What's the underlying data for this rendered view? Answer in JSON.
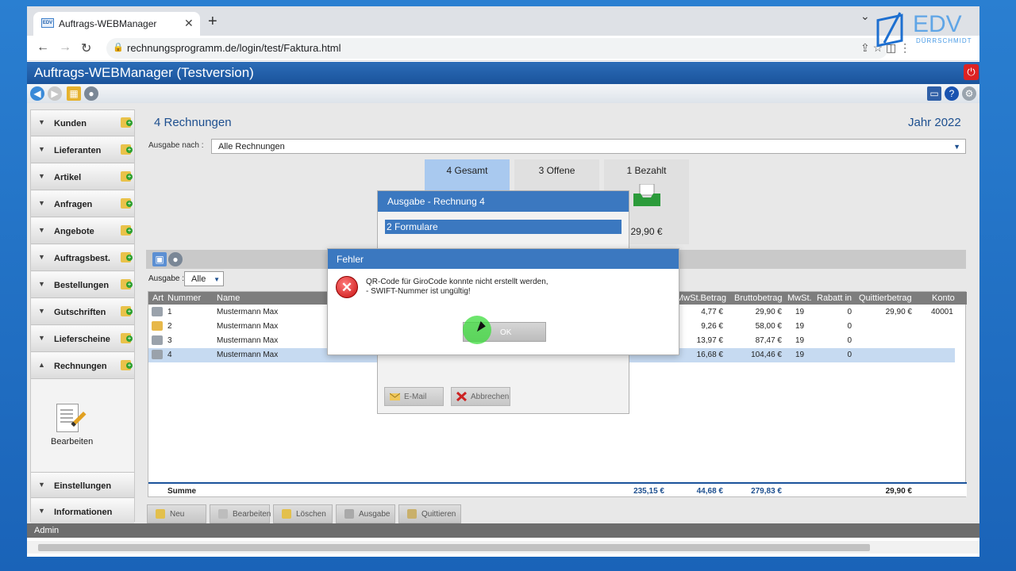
{
  "browser": {
    "tab_title": "Auftrags-WEBManager",
    "tab_favicon_text": "EDV",
    "url": "rechnungsprogramm.de/login/test/Faktura.html"
  },
  "app": {
    "title": "Auftrags-WEBManager (Testversion)",
    "status_user": "Admin"
  },
  "sidebar": {
    "items": [
      {
        "label": "Kunden"
      },
      {
        "label": "Lieferanten"
      },
      {
        "label": "Artikel"
      },
      {
        "label": "Anfragen"
      },
      {
        "label": "Angebote"
      },
      {
        "label": "Auftragsbest."
      },
      {
        "label": "Bestellungen"
      },
      {
        "label": "Gutschriften"
      },
      {
        "label": "Lieferscheine"
      },
      {
        "label": "Rechnungen"
      }
    ],
    "sub_action": "Bearbeiten",
    "bottom_items": [
      {
        "label": "Einstellungen"
      },
      {
        "label": "Informationen"
      }
    ]
  },
  "main": {
    "title": "4 Rechnungen",
    "year": "Jahr 2022",
    "ausgabe_nach_label": "Ausgabe nach :",
    "ausgabe_nach_value": "Alle Rechnungen",
    "stats": [
      {
        "label": "4 Gesamt",
        "value": ""
      },
      {
        "label": "3 Offene",
        "value": ""
      },
      {
        "label": "1 Bezahlt",
        "value": "29,90 €"
      }
    ],
    "ausgabe_label": "Ausgabe :",
    "ausgabe_value": "Alle",
    "columns": [
      "Art",
      "Nummer",
      "Name",
      "MwSt.Betrag",
      "Bruttobetrag",
      "MwSt.",
      "Rabatt in",
      "Quittierbetrag",
      "Konto"
    ],
    "rows": [
      {
        "nummer": "1",
        "name": "Mustermann Max",
        "mwst_betrag": "4,77 €",
        "brutto": "29,90 €",
        "mwst": "19",
        "rabatt": "0",
        "quittier": "29,90 €",
        "konto": "40001",
        "icon": "printer"
      },
      {
        "nummer": "2",
        "name": "Mustermann Max",
        "mwst_betrag": "9,26 €",
        "brutto": "58,00 €",
        "mwst": "19",
        "rabatt": "0",
        "quittier": "",
        "konto": "",
        "icon": "envelope"
      },
      {
        "nummer": "3",
        "name": "Mustermann Max",
        "mwst_betrag": "13,97 €",
        "brutto": "87,47 €",
        "mwst": "19",
        "rabatt": "0",
        "quittier": "",
        "konto": "",
        "icon": "printer"
      },
      {
        "nummer": "4",
        "name": "Mustermann Max",
        "mwst_betrag": "16,68 €",
        "brutto": "104,46 €",
        "mwst": "19",
        "rabatt": "0",
        "quittier": "",
        "konto": "",
        "icon": "printer"
      }
    ],
    "sum": {
      "label": "Summe",
      "netto": "235,15 €",
      "mwst_betrag": "44,68 €",
      "brutto": "279,83 €",
      "quittier": "29,90 €"
    },
    "buttons": [
      "Neu",
      "Bearbeiten",
      "Löschen",
      "Ausgabe",
      "Quittieren"
    ]
  },
  "ausgabe_dialog": {
    "title": "Ausgabe - Rechnung 4",
    "section": "2 Formulare",
    "email_label": "E-Mail",
    "cancel_label": "Abbrechen"
  },
  "error_dialog": {
    "title": "Fehler",
    "line1": "QR-Code für GiroCode konnte nicht erstellt werden,",
    "line2": "- SWIFT-Nummer ist ungültig!",
    "ok_label": "OK"
  },
  "logo": {
    "text": "EDV",
    "subtext": "DÜRRSCHMIDT"
  },
  "colors": {
    "header_blue": "#1a539b",
    "dialog_blue": "#3b78c0",
    "active_stat": "#a9c9ef",
    "selected_row": "#c6daf1",
    "error_red": "#c80f0f"
  }
}
